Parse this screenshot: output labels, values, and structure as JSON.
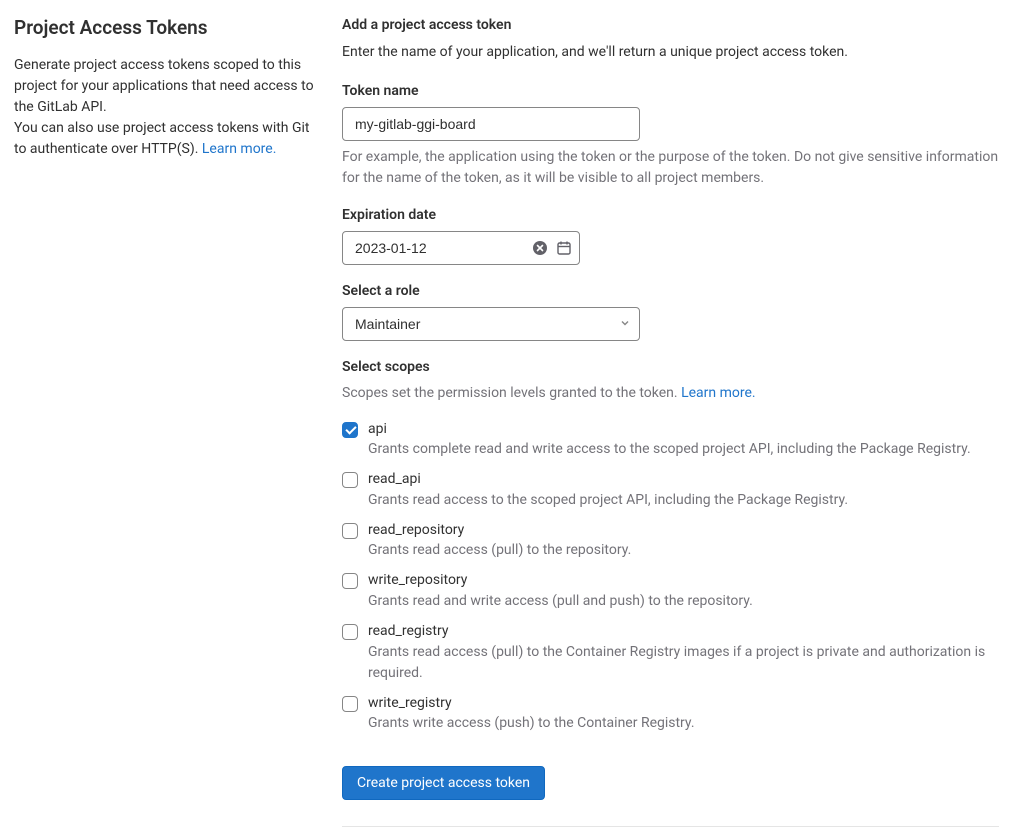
{
  "left": {
    "title": "Project Access Tokens",
    "desc1": "Generate project access tokens scoped to this project for your applications that need access to the GitLab API.",
    "desc2_pre": "You can also use project access tokens with Git to authenticate over HTTP(S). ",
    "learn_more": "Learn more."
  },
  "form": {
    "heading": "Add a project access token",
    "subheading": "Enter the name of your application, and we'll return a unique project access token.",
    "token_name_label": "Token name",
    "token_name_value": "my-gitlab-ggi-board",
    "token_name_help": "For example, the application using the token or the purpose of the token. Do not give sensitive information for the name of the token, as it will be visible to all project members.",
    "expiration_label": "Expiration date",
    "expiration_value": "2023-01-12",
    "role_label": "Select a role",
    "role_value": "Maintainer",
    "scopes_label": "Select scopes",
    "scopes_sub_pre": "Scopes set the permission levels granted to the token. ",
    "scopes_learn_more": "Learn more.",
    "submit_label": "Create project access token"
  },
  "scopes": [
    {
      "key": "api",
      "checked": true,
      "desc": "Grants complete read and write access to the scoped project API, including the Package Registry."
    },
    {
      "key": "read_api",
      "checked": false,
      "desc": "Grants read access to the scoped project API, including the Package Registry."
    },
    {
      "key": "read_repository",
      "checked": false,
      "desc": "Grants read access (pull) to the repository."
    },
    {
      "key": "write_repository",
      "checked": false,
      "desc": "Grants read and write access (pull and push) to the repository."
    },
    {
      "key": "read_registry",
      "checked": false,
      "desc": "Grants read access (pull) to the Container Registry images if a project is private and authorization is required."
    },
    {
      "key": "write_registry",
      "checked": false,
      "desc": "Grants write access (push) to the Container Registry."
    }
  ]
}
